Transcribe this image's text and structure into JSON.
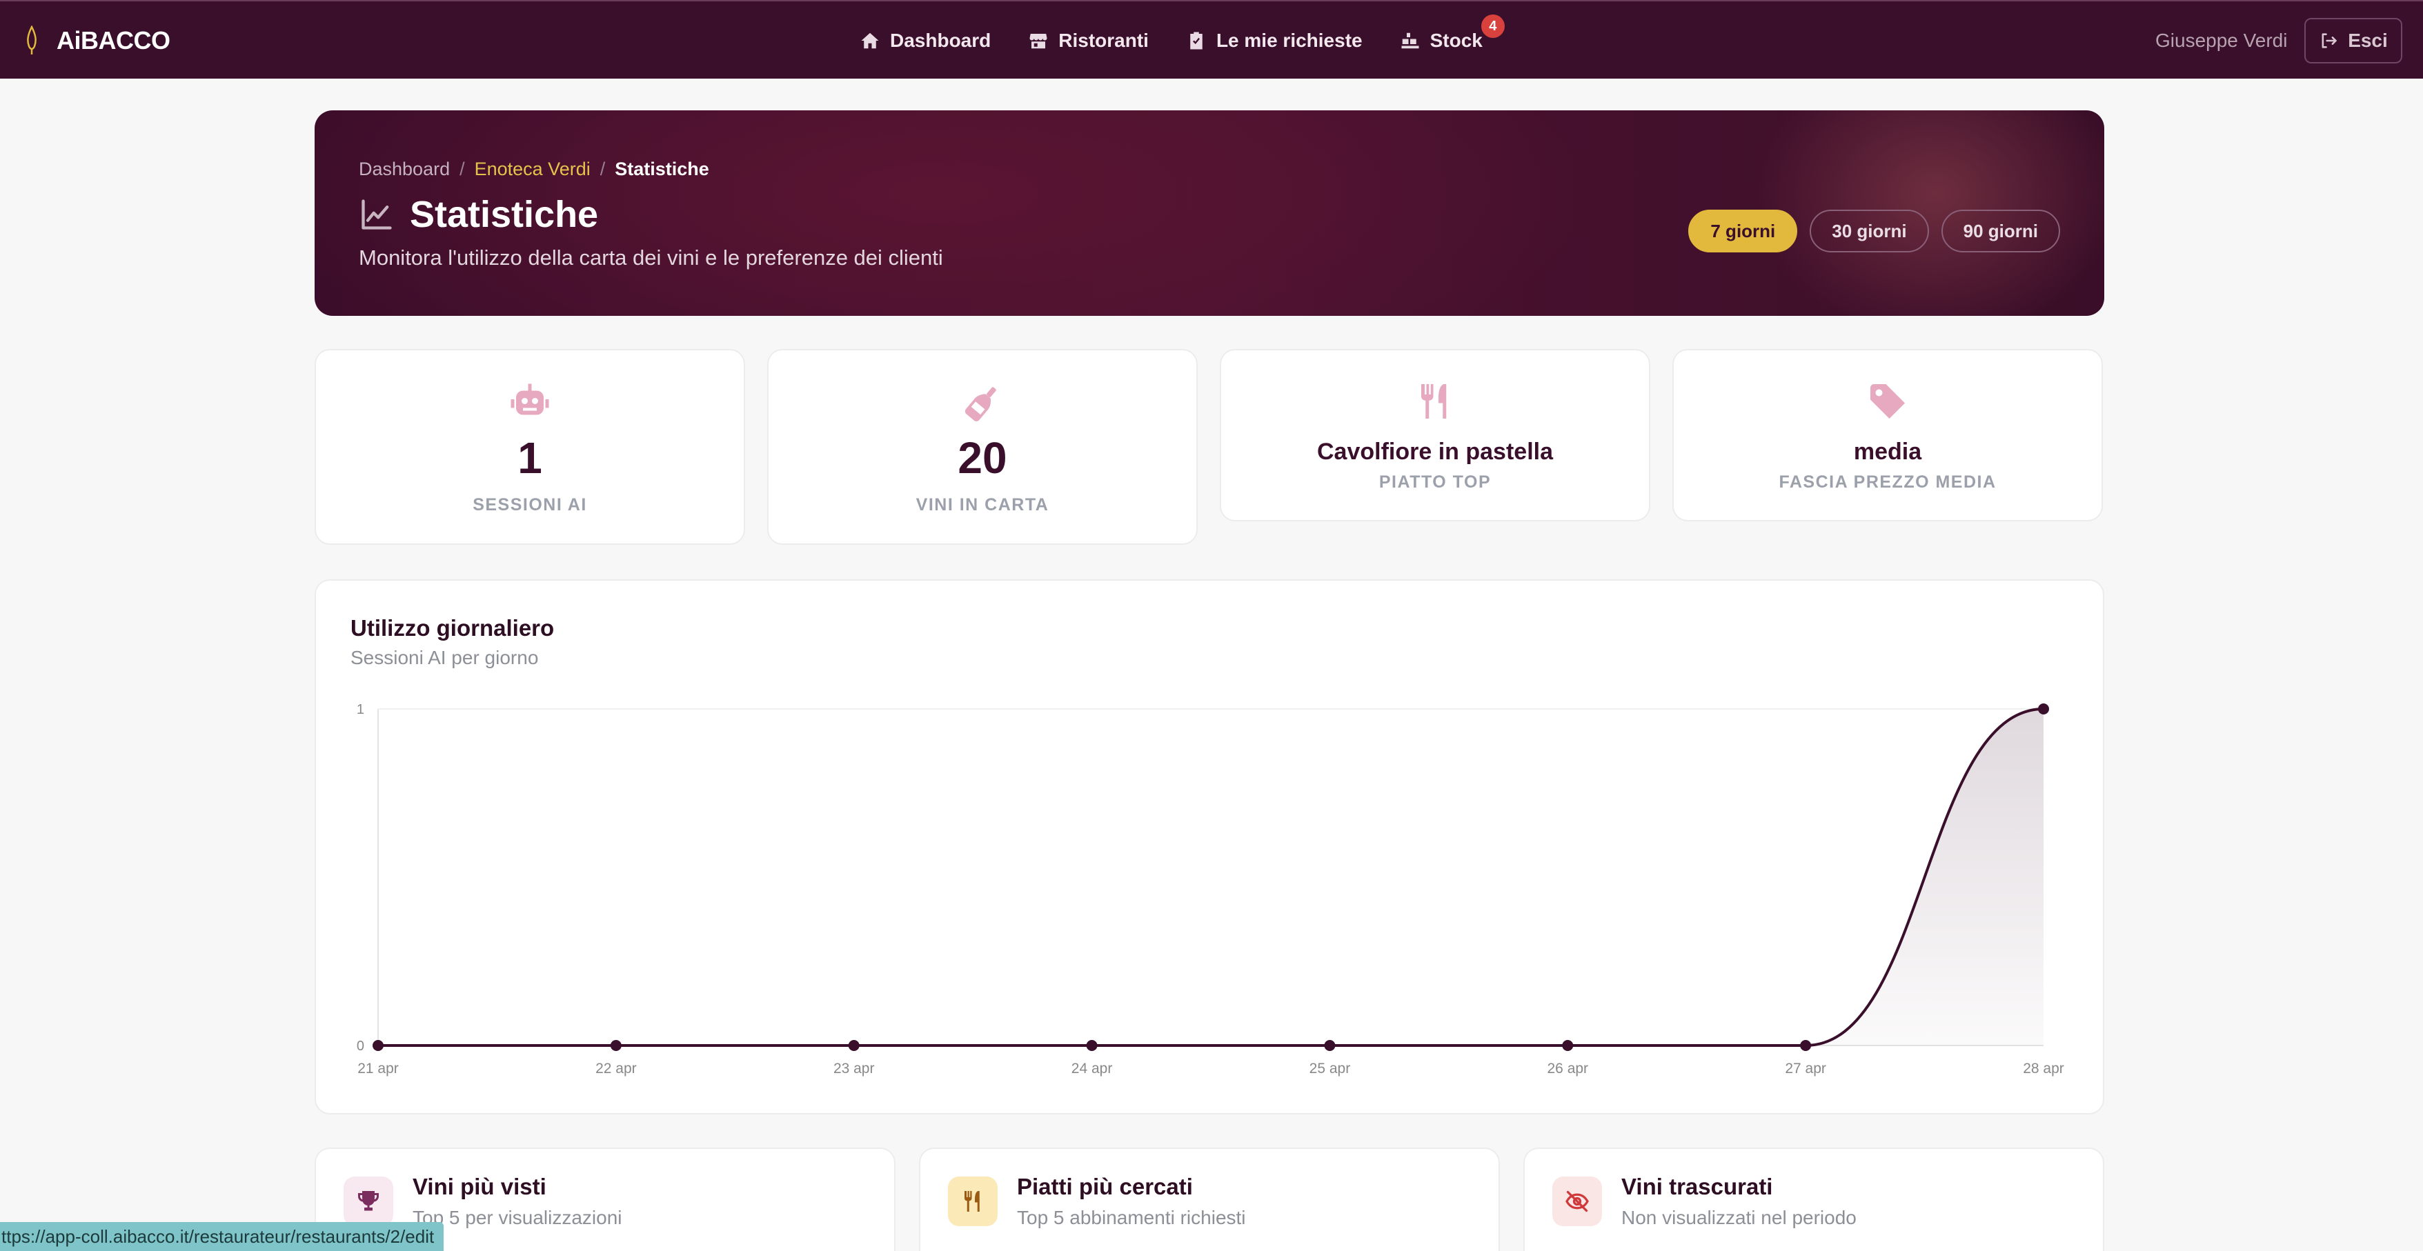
{
  "navbar": {
    "brand": "AiBACCO",
    "links": [
      {
        "label": "Dashboard",
        "icon": "home-icon"
      },
      {
        "label": "Ristoranti",
        "icon": "store-icon"
      },
      {
        "label": "Le mie richieste",
        "icon": "clipboard-check-icon"
      },
      {
        "label": "Stock",
        "icon": "boxes-icon",
        "badge": "4"
      }
    ],
    "user_name": "Giuseppe Verdi",
    "logout_label": "Esci"
  },
  "hero": {
    "breadcrumb": [
      "Dashboard",
      "Enoteca Verdi",
      "Statistiche"
    ],
    "title": "Statistiche",
    "subtitle": "Monitora l'utilizzo della carta dei vini e le preferenze dei clienti",
    "periods": [
      {
        "label": "7 giorni",
        "active": true
      },
      {
        "label": "30 giorni",
        "active": false
      },
      {
        "label": "90 giorni",
        "active": false
      }
    ]
  },
  "stats": [
    {
      "value": "1",
      "label": "SESSIONI AI",
      "icon": "robot-icon"
    },
    {
      "value": "20",
      "label": "VINI IN CARTA",
      "icon": "wine-bottle-icon"
    },
    {
      "value": "Cavolfiore in pastella",
      "label": "PIATTO TOP",
      "icon": "fork-knife-icon"
    },
    {
      "value": "media",
      "label": "FASCIA PREZZO MEDIA",
      "icon": "tag-icon"
    }
  ],
  "daily_usage": {
    "title": "Utilizzo giornaliero",
    "subtitle": "Sessioni AI per giorno"
  },
  "chart_data": {
    "type": "area",
    "title": "Utilizzo giornaliero",
    "subtitle": "Sessioni AI per giorno",
    "categories": [
      "21 apr",
      "22 apr",
      "23 apr",
      "24 apr",
      "25 apr",
      "26 apr",
      "27 apr",
      "28 apr"
    ],
    "values": [
      0,
      0,
      0,
      0,
      0,
      0,
      0,
      1
    ],
    "y_ticks": [
      "0",
      "1"
    ],
    "ylim": [
      0,
      1
    ],
    "xlabel": "",
    "ylabel": "",
    "grid": false,
    "line_color": "#3a0f2c"
  },
  "bottom_cards": [
    {
      "title": "Vini più visti",
      "subtitle": "Top 5 per visualizzazioni",
      "icon": "trophy-icon"
    },
    {
      "title": "Piatti più cercati",
      "subtitle": "Top 5 abbinamenti richiesti",
      "icon": "utensils-icon"
    },
    {
      "title": "Vini trascurati",
      "subtitle": "Non visualizzati nel periodo",
      "icon": "eye-slash-icon"
    }
  ],
  "status_url": "ttps://app-coll.aibacco.it/restaurateur/restaurants/2/edit",
  "colors": {
    "primary": "#3a0f2c",
    "accent": "#e2b93d",
    "badge": "#d9413d",
    "icon_pink": "#e7a9bf"
  }
}
